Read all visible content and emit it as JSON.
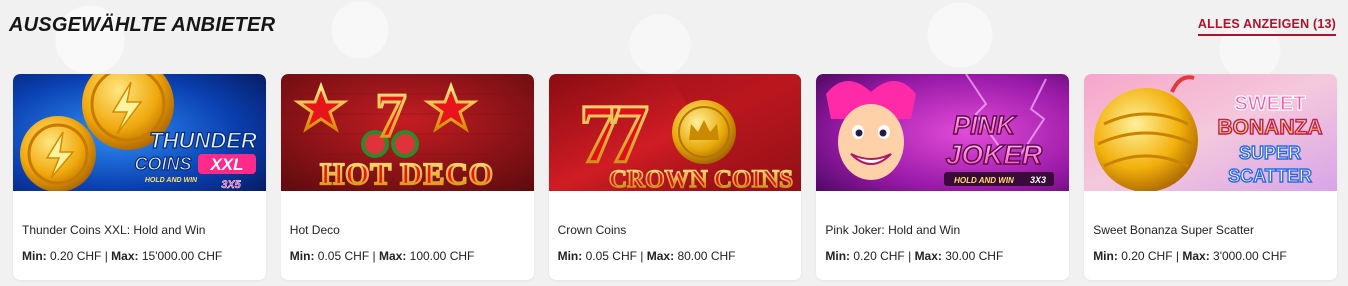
{
  "section": {
    "title": "AUSGEWÄHLTE ANBIETER",
    "show_all_label": "ALLES ANZEIGEN (13)"
  },
  "labels": {
    "min": "Min:",
    "max": "Max:",
    "separator": "|"
  },
  "games": [
    {
      "name": "Thunder Coins XXL: Hold and Win",
      "min": "0.20 CHF",
      "max": "15'000.00 CHF",
      "art": {
        "line1": "THUNDER",
        "line2": "COINS",
        "badge": "XXL",
        "line3": "HOLD AND WIN",
        "line4": "3X5"
      }
    },
    {
      "name": "Hot Deco",
      "min": "0.05 CHF",
      "max": "100.00 CHF",
      "art": {
        "line1": "7",
        "line2": "HOT DECO"
      }
    },
    {
      "name": "Crown Coins",
      "min": "0.05 CHF",
      "max": "80.00 CHF",
      "art": {
        "line1": "77",
        "line2": "CROWN COINS"
      }
    },
    {
      "name": "Pink Joker: Hold and Win",
      "min": "0.20 CHF",
      "max": "30.00 CHF",
      "art": {
        "line1": "PINK",
        "line2": "JOKER",
        "line3": "HOLD AND WIN",
        "line4": "3X3"
      }
    },
    {
      "name": "Sweet Bonanza Super Scatter",
      "min": "0.20 CHF",
      "max": "3'000.00 CHF",
      "art": {
        "line1": "SWEET",
        "line2": "BONANZA",
        "line3": "SUPER",
        "line4": "SCATTER"
      }
    }
  ],
  "colors": {
    "accent": "#b0122b",
    "title": "#161616",
    "card_bg": "#ffffff",
    "page_bg": "#f1f1f1"
  }
}
